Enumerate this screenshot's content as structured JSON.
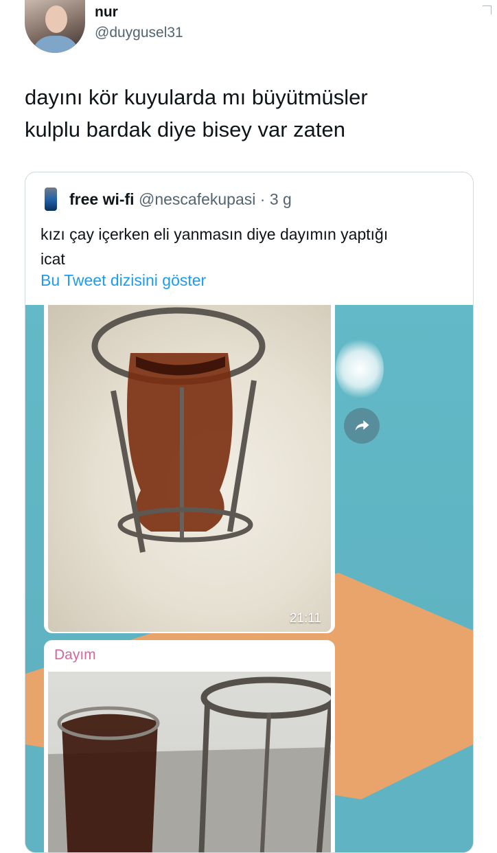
{
  "tweet": {
    "author_name": "nur",
    "author_handle": "@duygusel31",
    "text_lines": [
      "dayını kör kuyularda mı büyütmüsler",
      "kulplu bardak diye bisey var zaten"
    ]
  },
  "quoted": {
    "author_name": "free wi-fi",
    "author_handle": "@nescafekupasi",
    "meta_sep": "·",
    "age": "3 g",
    "text_lines": [
      "kızı çay içerken eli yanmasın diye dayımın yaptığı",
      "icat"
    ],
    "thread_link": "Bu Tweet dizisini göster",
    "media": {
      "message_time": "21:11",
      "second_sender": "Dayım"
    }
  },
  "colors": {
    "link": "#1d9bf0",
    "secondary_text": "#536471",
    "sender_name": "#d9649d",
    "chat_background": "#5fb3c2",
    "dune": "#e9a46b"
  },
  "icons": {
    "more": "chevron-icon",
    "share": "forward-arrow-icon"
  }
}
